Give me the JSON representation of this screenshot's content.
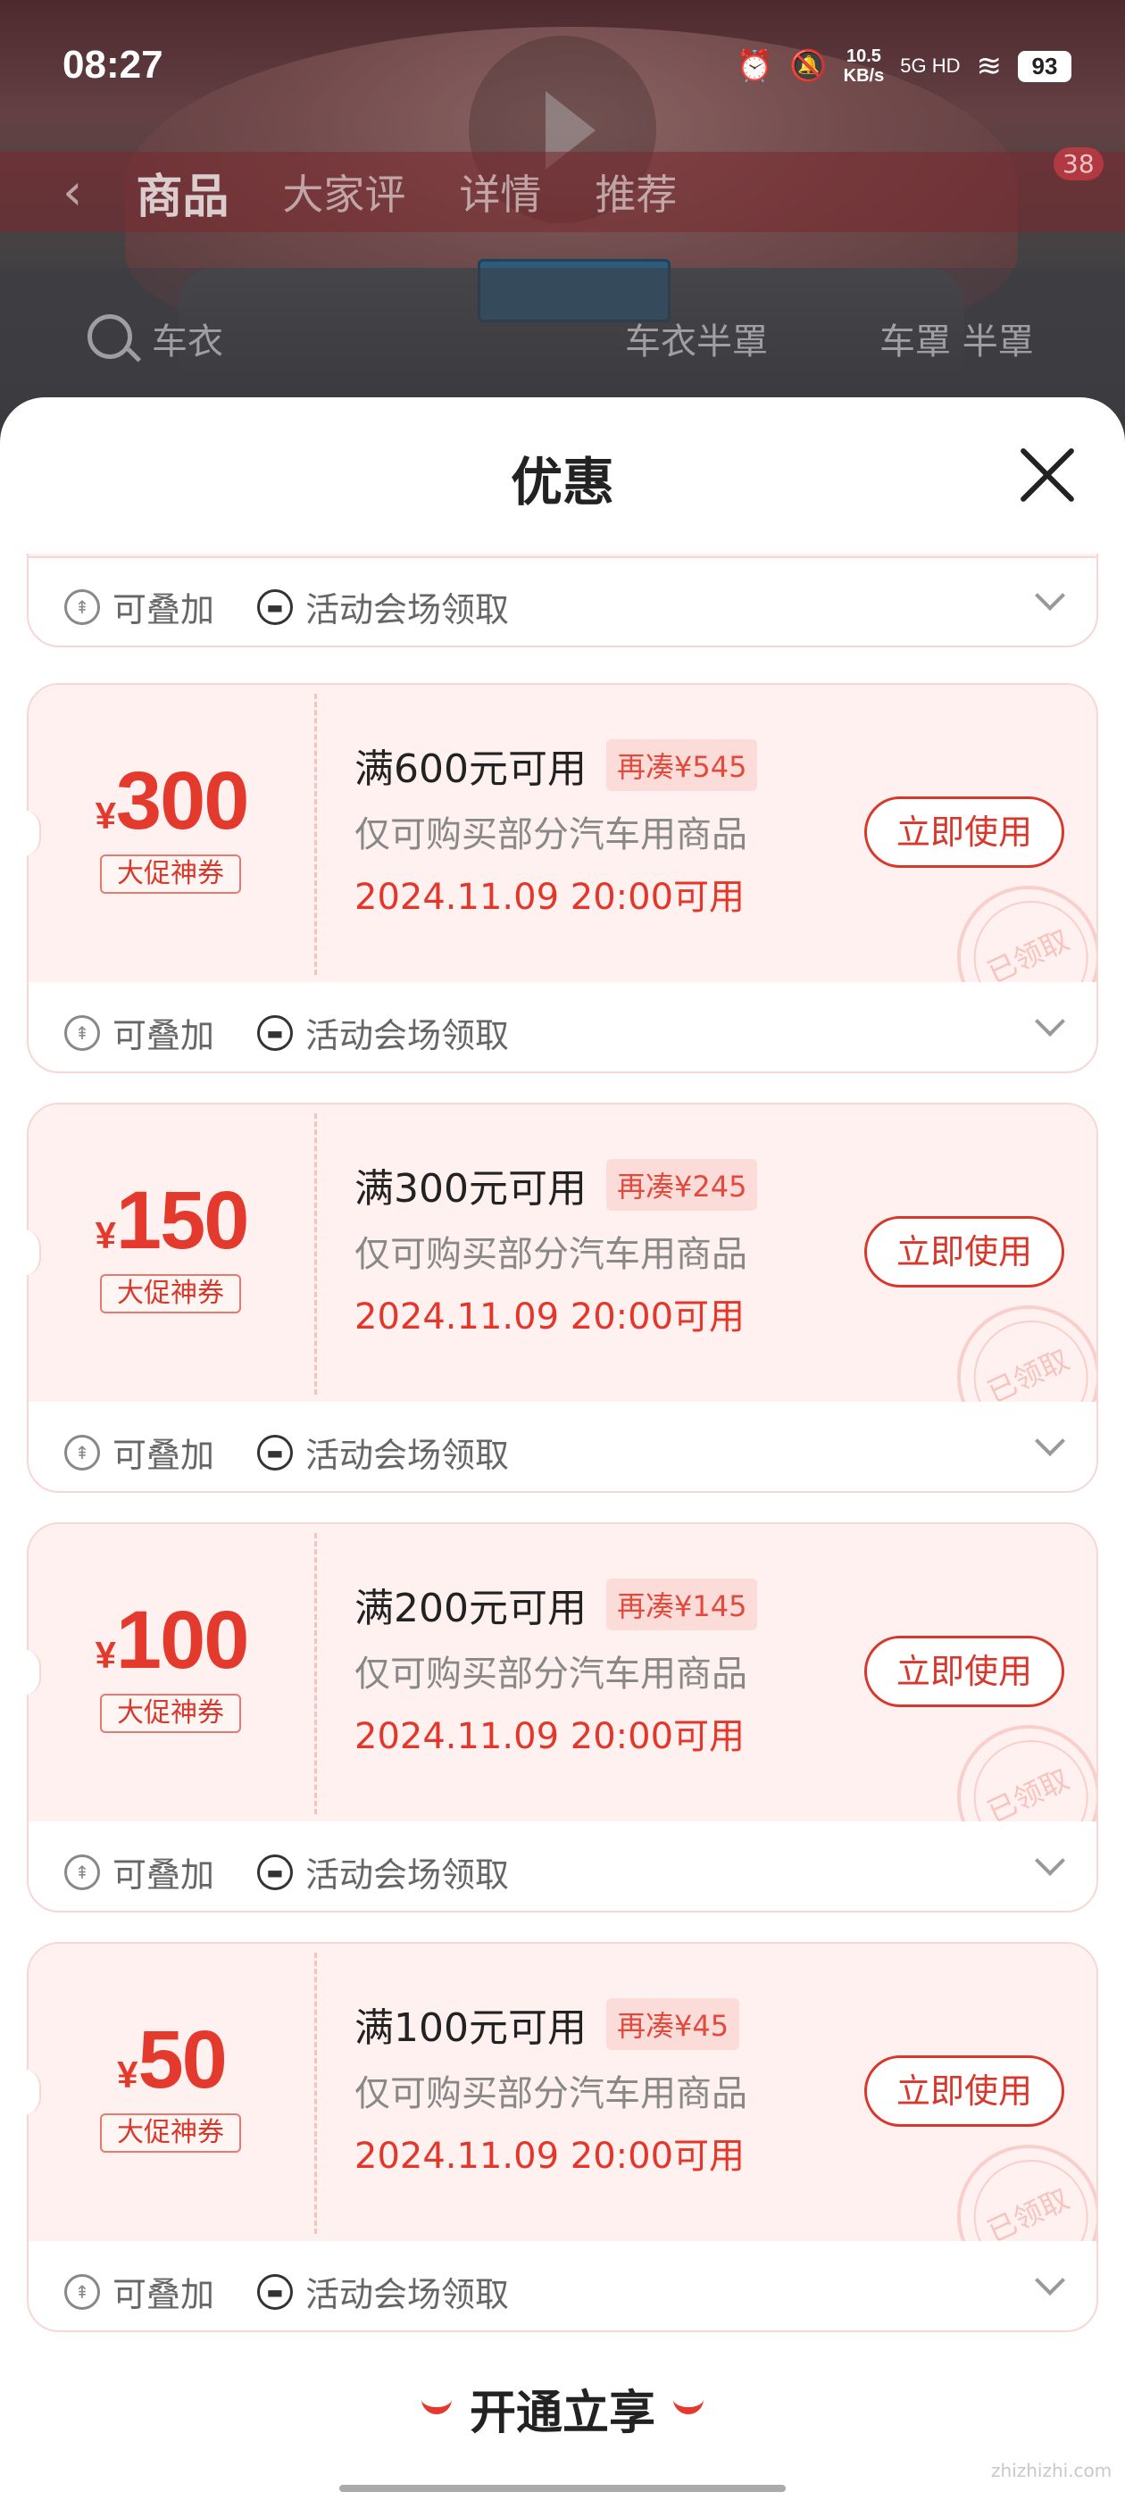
{
  "status_bar": {
    "time": "08:27",
    "net_speed": "10.5",
    "net_unit": "KB/s",
    "signal_label": "5G HD",
    "battery": "93"
  },
  "background_page": {
    "tabs": [
      "商品",
      "大家评",
      "详情",
      "推荐"
    ],
    "cart_badge": "38",
    "search_text": "车衣",
    "search_tags": [
      "车衣半罩",
      "车罩 半罩"
    ]
  },
  "sheet": {
    "title": "优惠"
  },
  "coupon_common": {
    "currency": "¥",
    "tag": "大促神券",
    "scope": "仅可购买部分汽车用商品",
    "valid": "2024.11.09 20:00可用",
    "button": "立即使用",
    "stamp": "已领取",
    "footer_stack": "可叠加",
    "footer_source": "活动会场领取"
  },
  "coupons": [
    {
      "amount": "300",
      "condition": "满600元可用",
      "rest": "再凑¥545"
    },
    {
      "amount": "150",
      "condition": "满300元可用",
      "rest": "再凑¥245"
    },
    {
      "amount": "100",
      "condition": "满200元可用",
      "rest": "再凑¥145"
    },
    {
      "amount": "50",
      "condition": "满100元可用",
      "rest": "再凑¥45"
    }
  ],
  "promo": {
    "label": "开通立享"
  },
  "watermark": "zhizhizhi.com",
  "colors": {
    "accent_red": "#e43a2e",
    "coupon_bg": "#fff1ef"
  }
}
